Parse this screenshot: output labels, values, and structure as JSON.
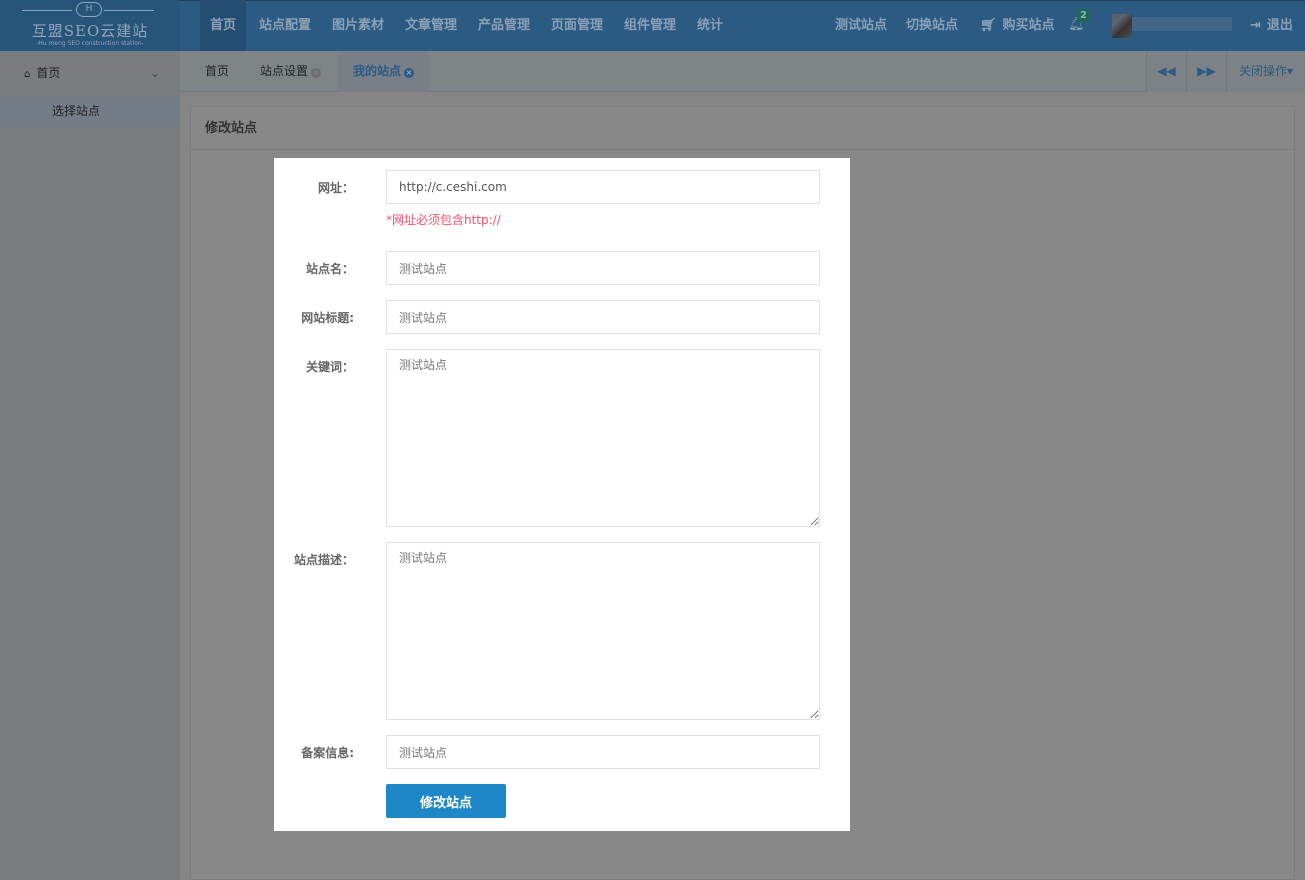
{
  "logo": {
    "title": "互盟SEO云建站",
    "subtitle": "-Hu meng SEO construction station-"
  },
  "nav": [
    "首页",
    "站点配置",
    "图片素材",
    "文章管理",
    "产品管理",
    "页面管理",
    "组件管理",
    "统计"
  ],
  "right_nav": {
    "test_site": "测试站点",
    "switch_site": "切换站点",
    "buy_site": "购买站点",
    "notifications": "2",
    "logout": "退出"
  },
  "sidebar": {
    "home": "首页",
    "items": [
      "选择站点"
    ]
  },
  "tabs": [
    {
      "label": "首页"
    },
    {
      "label": "站点设置"
    },
    {
      "label": "我的站点"
    }
  ],
  "tab_actions": {
    "close_ops": "关闭操作"
  },
  "panel": {
    "title": "修改站点"
  },
  "form": {
    "url_label": "网址：",
    "url_value": "http://c.ceshi.com",
    "url_hint": "*网址必须包含http://",
    "name_label": "站点名：",
    "name_value": "测试站点",
    "title_label": "网站标题:",
    "title_value": "测试站点",
    "keywords_label": "关键词：",
    "keywords_value": "测试站点",
    "desc_label": "站点描述：",
    "desc_value": "测试站点",
    "icp_label": "备案信息:",
    "icp_value": "测试站点",
    "submit": "修改站点"
  },
  "colors": {
    "accent": "#1e87c8",
    "hint": "#ff4d6a",
    "badge": "#1b7a5a"
  }
}
